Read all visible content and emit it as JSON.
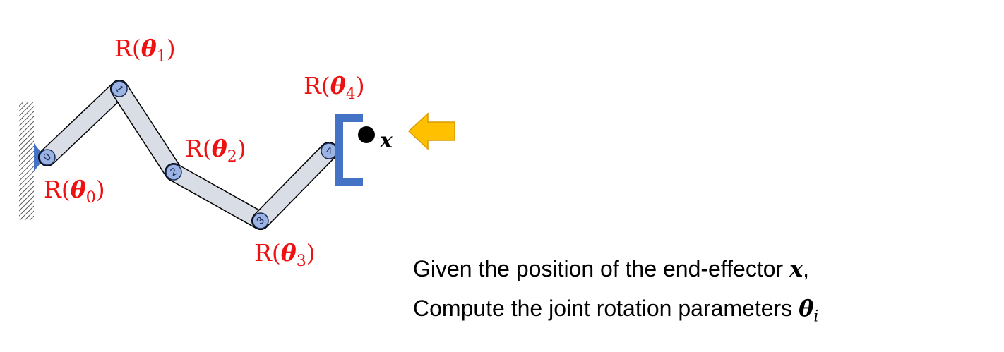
{
  "joints": [
    {
      "id": "0",
      "label": "R(θ",
      "sub": "0",
      "close": ")"
    },
    {
      "id": "1",
      "label": "R(θ",
      "sub": "1",
      "close": ")"
    },
    {
      "id": "2",
      "label": "R(θ",
      "sub": "2",
      "close": ")"
    },
    {
      "id": "3",
      "label": "R(θ",
      "sub": "3",
      "close": ")"
    },
    {
      "id": "4",
      "label": "R(θ",
      "sub": "4",
      "close": ")"
    }
  ],
  "target": {
    "label": "x"
  },
  "caption": {
    "line1_text": "Given the position of the end-effector ",
    "line1_var": "x",
    "line1_end": ",",
    "line2_text": "Compute the joint rotation parameters ",
    "line2_var": "θ",
    "line2_sub": "i"
  },
  "colors": {
    "label": "#ee1111",
    "link_fill": "#d8dde6",
    "joint_fill": "#9bb4e4",
    "gripper": "#4472c4",
    "arrow": "#ffc000"
  }
}
